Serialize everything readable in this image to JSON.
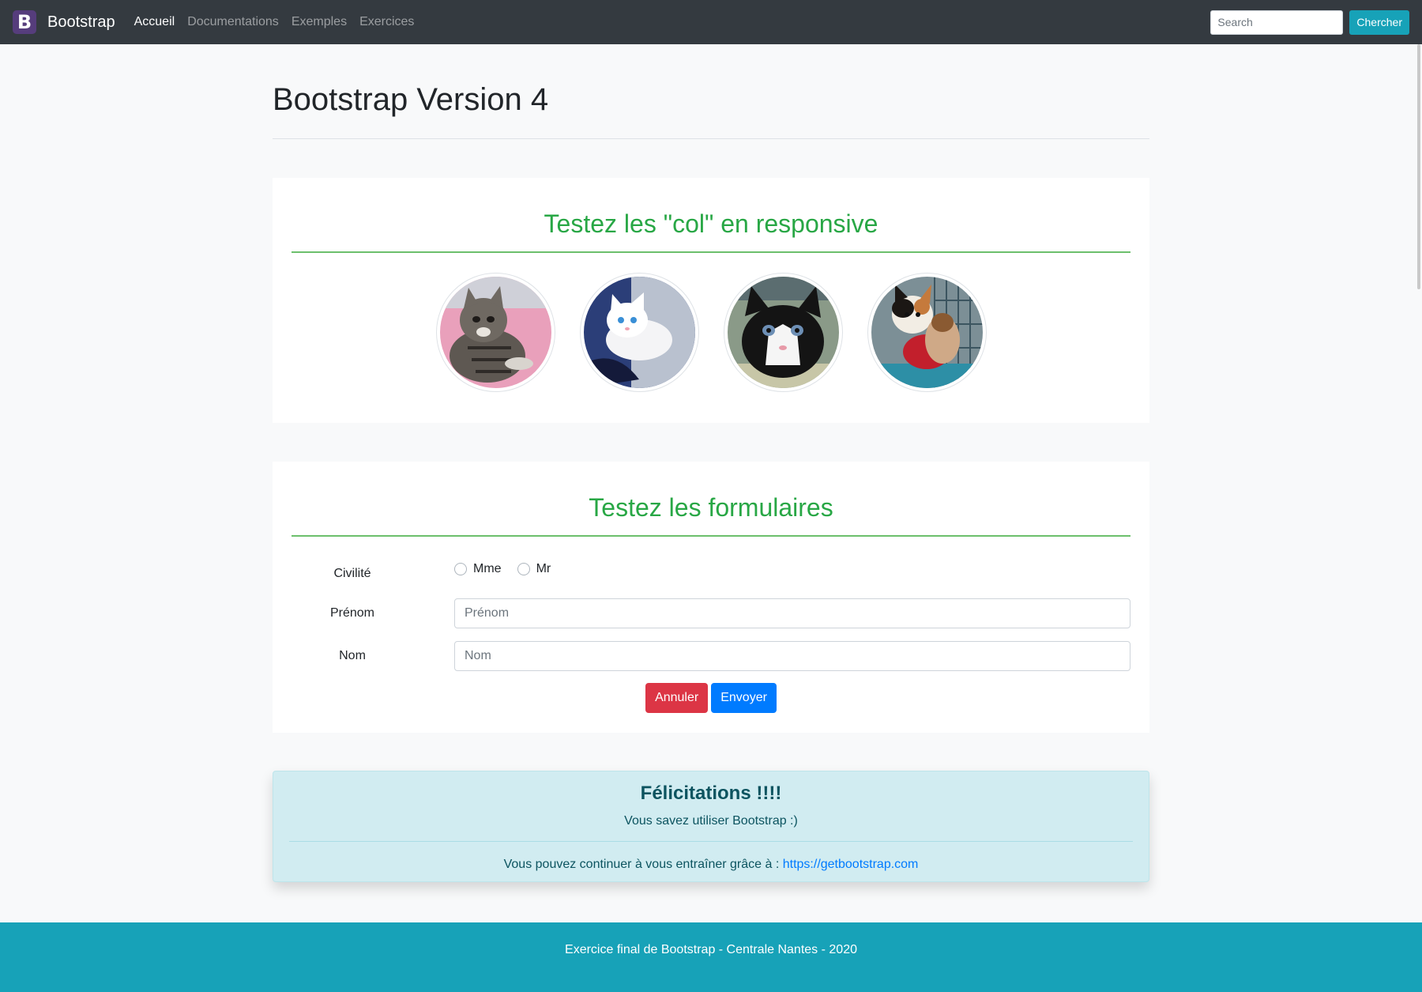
{
  "navbar": {
    "brand_letter": "B",
    "brand": "Bootstrap",
    "links": [
      {
        "label": "Accueil",
        "active": true
      },
      {
        "label": "Documentations",
        "active": false
      },
      {
        "label": "Exemples",
        "active": false
      },
      {
        "label": "Exercices",
        "active": false
      }
    ],
    "search_placeholder": "Search",
    "search_button": "Chercher"
  },
  "page": {
    "title": "Bootstrap Version 4"
  },
  "gallery": {
    "title": "Testez les \"col\" en responsive",
    "images": [
      "tabby-kitten-photo",
      "white-kitten-photo",
      "black-white-kitten-photo",
      "calico-kitten-photo"
    ]
  },
  "form": {
    "title": "Testez les formulaires",
    "civility_label": "Civilité",
    "civility_options": [
      "Mme",
      "Mr"
    ],
    "firstname_label": "Prénom",
    "firstname_placeholder": "Prénom",
    "lastname_label": "Nom",
    "lastname_placeholder": "Nom",
    "cancel_label": "Annuler",
    "submit_label": "Envoyer"
  },
  "alert": {
    "heading": "Félicitations !!!!",
    "sub": "Vous savez utiliser Bootstrap :)",
    "foot_text": "Vous pouvez continuer à vous entraîner grâce à :",
    "link": "https://getbootstrap.com"
  },
  "footer": {
    "text": "Exercice final de Bootstrap - Centrale Nantes - 2020"
  },
  "colors": {
    "navbar": "#343a40",
    "accent_green": "#28a745",
    "info": "#17a2b8",
    "danger": "#dc3545",
    "primary": "#007bff"
  }
}
